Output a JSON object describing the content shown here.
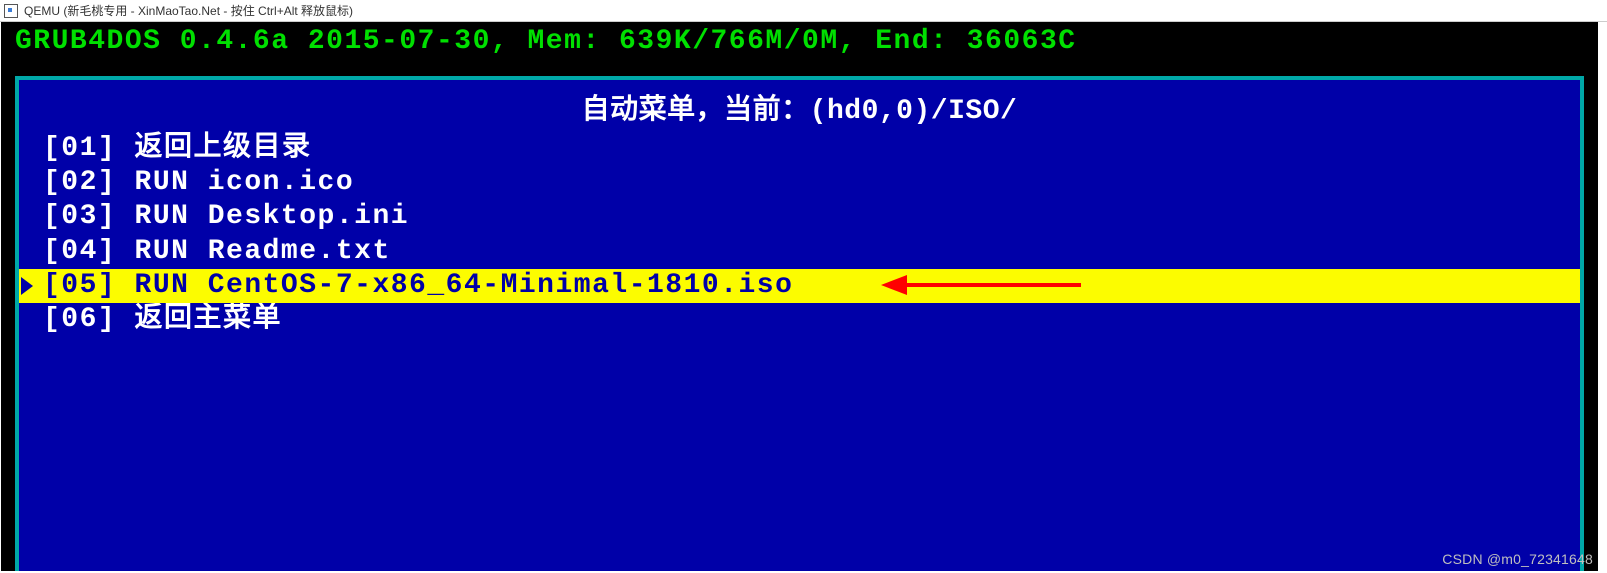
{
  "titlebar": {
    "text": "QEMU (新毛桃专用 - XinMaoTao.Net - 按住 Ctrl+Alt 释放鼠标)"
  },
  "grub": {
    "header": "GRUB4DOS 0.4.6a 2015-07-30, Mem: 639K/766M/0M, End: 36063C"
  },
  "menu": {
    "title": "自动菜单，当前：(hd0,0)/ISO/",
    "items": [
      {
        "label": "[01] 返回上级目录",
        "selected": false
      },
      {
        "label": "[02] RUN icon.ico",
        "selected": false
      },
      {
        "label": "[03] RUN Desktop.ini",
        "selected": false
      },
      {
        "label": "[04] RUN Readme.txt",
        "selected": false
      },
      {
        "label": "[05] RUN CentOS-7-x86_64-Minimal-1810.iso",
        "selected": true
      },
      {
        "label": "[06] 返回主菜单",
        "selected": false
      }
    ]
  },
  "watermark": {
    "text": "CSDN @m0_72341648"
  }
}
